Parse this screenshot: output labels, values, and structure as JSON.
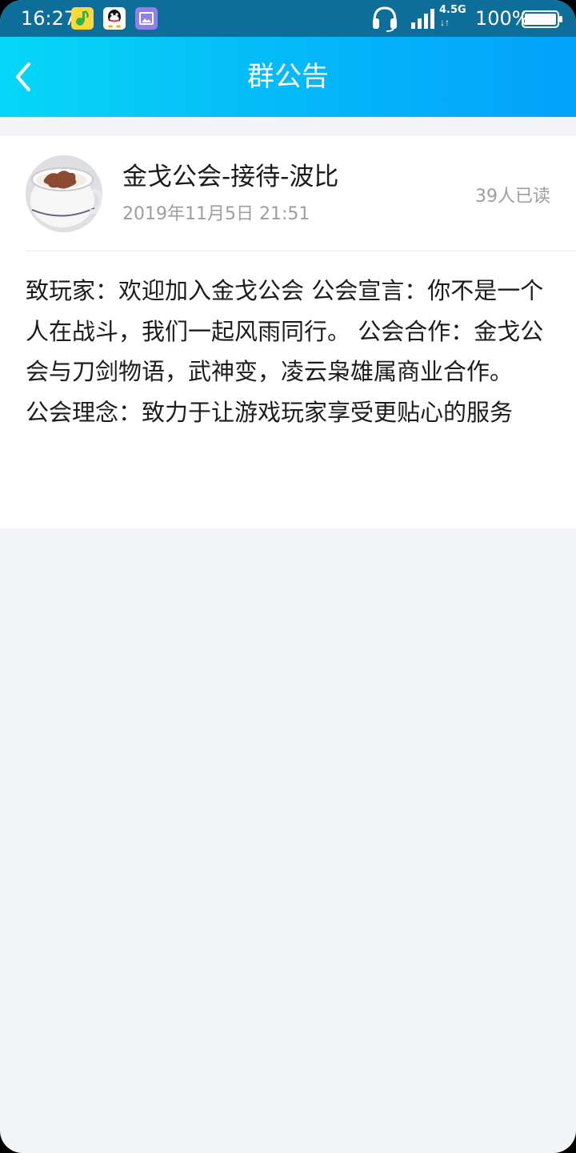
{
  "status_bar": {
    "time": "16:27",
    "network": "4.5G",
    "network_arrows": "↓↑",
    "battery": "100%",
    "icons": [
      "music-app-icon",
      "qq-app-icon",
      "gallery-app-icon",
      "headset-icon",
      "signal-icon",
      "battery-icon"
    ]
  },
  "nav": {
    "title": "群公告",
    "back_icon": "chevron-left-icon"
  },
  "notice": {
    "author": "金戈公会-接待-波比",
    "time": "2019年11月5日 21:51",
    "read_count": "39人已读",
    "content_line1": "致玩家：欢迎加入金戈公会 公会宣言：你不是一个人在战斗，我们一起风雨同行。 公会合作：金戈公会与刀剑物语，武神变，凌云枭雄属商业合作。",
    "content_line2": "公会理念：致力于让游戏玩家享受更贴心的服务"
  },
  "colors": {
    "status_bar": "#0d6e99",
    "nav_gradient_start": "#06d7f8",
    "nav_gradient_end": "#02a2fb",
    "page_background": "#f3f4f8",
    "card_background": "#ffffff",
    "secondary_text": "#9b9ea4"
  }
}
